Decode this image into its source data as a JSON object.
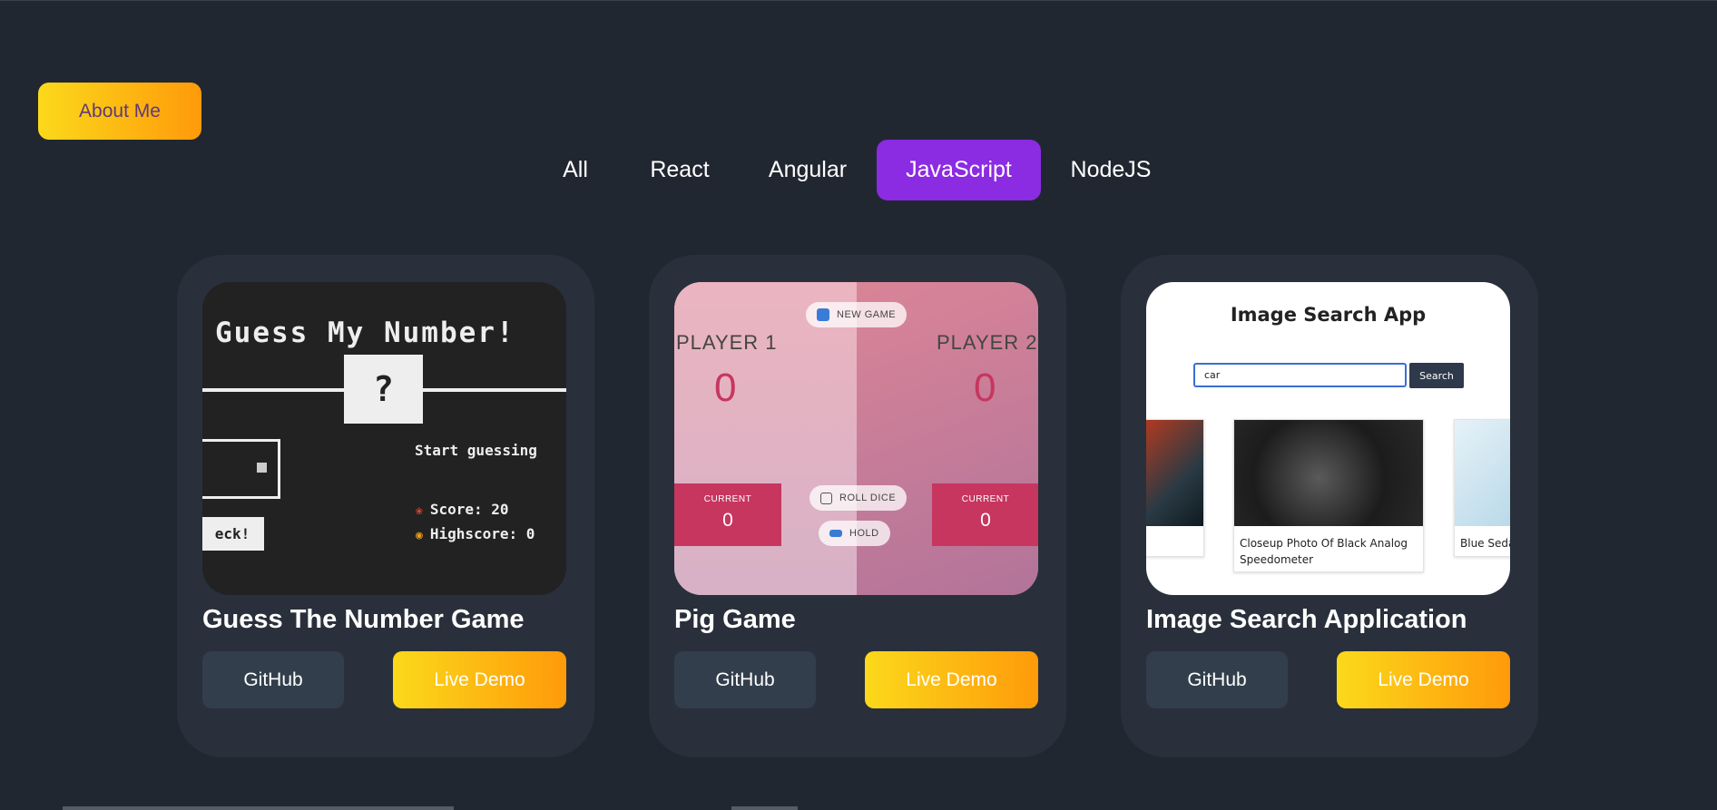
{
  "header": {
    "about_label": "About Me"
  },
  "filters": [
    {
      "label": "All",
      "active": false
    },
    {
      "label": "React",
      "active": false
    },
    {
      "label": "Angular",
      "active": false
    },
    {
      "label": "JavaScript",
      "active": true
    },
    {
      "label": "NodeJS",
      "active": false
    }
  ],
  "colors": {
    "background": "#212731",
    "card": "#29303b",
    "accent": "#8b2be2",
    "demo_gradient_start": "#fbd91b",
    "demo_gradient_end": "#ff9a0a"
  },
  "projects": [
    {
      "title": "Guess The Number Game",
      "github_label": "GitHub",
      "demo_label": "Live Demo",
      "preview": {
        "heading": "Guess My Number!",
        "mystery": "?",
        "check": "eck!",
        "message": "Start guessing",
        "score": "Score: 20",
        "highscore": "Highscore: 0"
      }
    },
    {
      "title": "Pig Game",
      "github_label": "GitHub",
      "demo_label": "Live Demo",
      "preview": {
        "new_game": "NEW GAME",
        "player1": "PLAYER 1",
        "player2": "PLAYER 2",
        "score1": "0",
        "score2": "0",
        "current_label": "CURRENT",
        "current1": "0",
        "current2": "0",
        "roll": "ROLL DICE",
        "hold": "HOLD"
      }
    },
    {
      "title": "Image Search Application",
      "github_label": "GitHub",
      "demo_label": "Live Demo",
      "preview": {
        "heading": "Image Search App",
        "query": "car",
        "search_label": "Search",
        "captions": [
          "",
          "Closeup Photo Of Black Analog Speedometer",
          "Blue Seda"
        ]
      }
    }
  ]
}
